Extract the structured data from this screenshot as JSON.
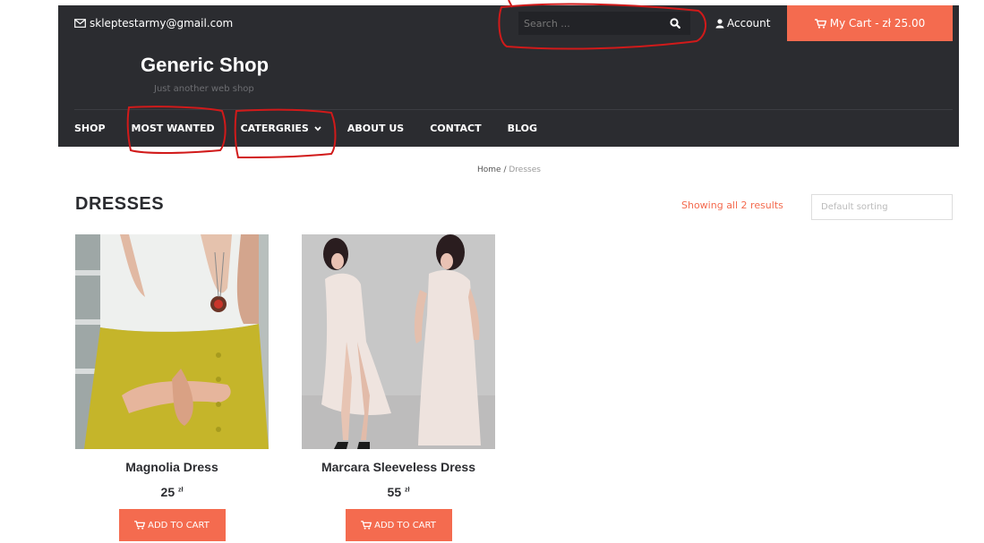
{
  "topbar": {
    "email": "skleptestarmy@gmail.com",
    "search_placeholder": "Search ...",
    "account_label": "Account",
    "cart_label": "My Cart - zł 25.00"
  },
  "header": {
    "site_title": "Generic Shop",
    "tagline": "Just another web shop"
  },
  "nav": {
    "items": [
      "SHOP",
      "MOST WANTED",
      "CATERGRIES",
      "ABOUT US",
      "CONTACT",
      "BLOG"
    ]
  },
  "breadcrumb": {
    "home": "Home",
    "separator": " / ",
    "current": "Dresses"
  },
  "main": {
    "title": "DRESSES",
    "result_count": "Showing all 2 results",
    "sorting": "Default sorting"
  },
  "products": [
    {
      "name": "Magnolia Dress",
      "price": "25",
      "currency": "zł",
      "button": "ADD TO CART"
    },
    {
      "name": "Marcara Sleeveless Dress",
      "price": "55",
      "currency": "zł",
      "button": "ADD TO CART"
    }
  ],
  "colors": {
    "accent": "#f46b4f",
    "header_bg": "#2b2c30",
    "annotation": "#d11a1a"
  },
  "icons": [
    "envelope-icon",
    "search-icon",
    "user-icon",
    "cart-icon",
    "chevron-down-icon"
  ]
}
